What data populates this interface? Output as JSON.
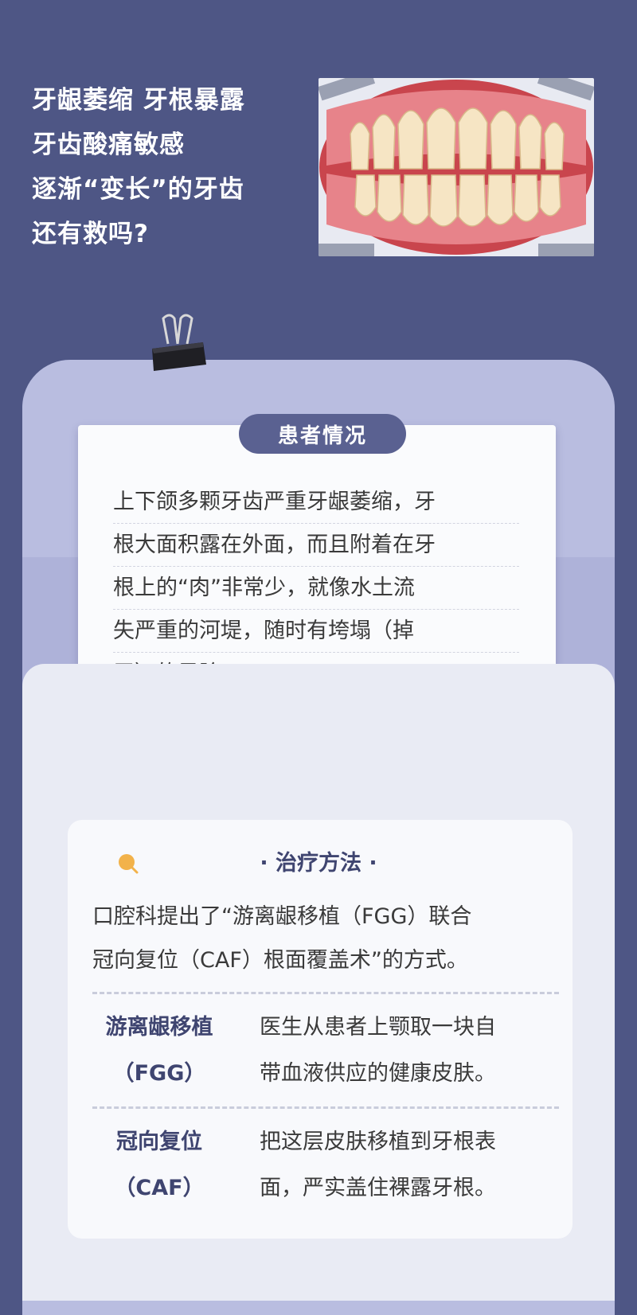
{
  "headline": {
    "lines": [
      "牙龈萎缩 牙根暴露",
      "牙齿酸痛敏感",
      "逐渐“变长”的牙齿",
      "还有救吗?"
    ]
  },
  "patient": {
    "badge": "患者情况",
    "lines": [
      "上下颌多颗牙齿严重牙龈萎缩，牙",
      "根大面积露在外面，而且附着在牙",
      "根上的“肉”非常少，就像水土流",
      "失严重的河堤，随时有垮塌（掉",
      "牙）的风险。"
    ]
  },
  "treatment": {
    "title": "· 治疗方法 ·",
    "intro_lines": [
      "口腔科提出了“游离龈移植（FGG）联合",
      "冠向复位（CAF）根面覆盖术”的方式。"
    ],
    "items": [
      {
        "term_lines": [
          "游离龈移植",
          "（FGG）"
        ],
        "desc_lines": [
          "医生从患者上颚取一块自",
          "带血液供应的健康皮肤。"
        ]
      },
      {
        "term_lines": [
          "冠向复位",
          "（CAF）"
        ],
        "desc_lines": [
          "把这层皮肤移植到牙根表",
          "面，严实盖住裸露牙根。"
        ]
      }
    ]
  },
  "colors": {
    "background": "#4e5685",
    "badge": "#5a6191",
    "accent_icon": "#f2b24a",
    "term_text": "#3f4570"
  }
}
